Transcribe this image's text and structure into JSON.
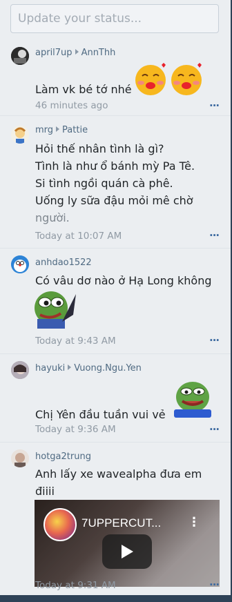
{
  "status": {
    "placeholder": "Update your status..."
  },
  "posts": [
    {
      "user": "april7up",
      "target": "AnnThh",
      "text": "Làm vk bé tớ nhé",
      "time": "46 minutes ago",
      "more": "..."
    },
    {
      "user": "mrg",
      "target": "Pattie",
      "text_lines": [
        "Hỏi thế nhân tình là gì?",
        "Tình là như ổ bánh mỳ Pa Tê.",
        "Si tình ngồi quán cà phê.",
        "Uống ly sữa đậu mỏi mê chờ",
        "người."
      ],
      "time": "Today at 10:07 AM",
      "more": "..."
    },
    {
      "user": "anhdao1522",
      "text": "Có vâu dơ nào ở Hạ Long không",
      "time": "Today at 9:43 AM",
      "more": "..."
    },
    {
      "user": "hayuki",
      "target": "Vuong.Ngu.Yen",
      "text": "Chị Yên đầu tuần vui vẻ",
      "time": "Today at 9:36 AM",
      "more": "..."
    },
    {
      "user": "hotga2trung",
      "text_lines": [
        "Anh lấy xe wavealpha đưa em",
        "điiii"
      ],
      "video_title": "7UPPERCUT...",
      "time": "Today at 9:31 AM",
      "more": "..."
    }
  ],
  "colors": {
    "link": "#4f6a82",
    "accent": "#3d6aa0",
    "edge": "#2e4257"
  }
}
